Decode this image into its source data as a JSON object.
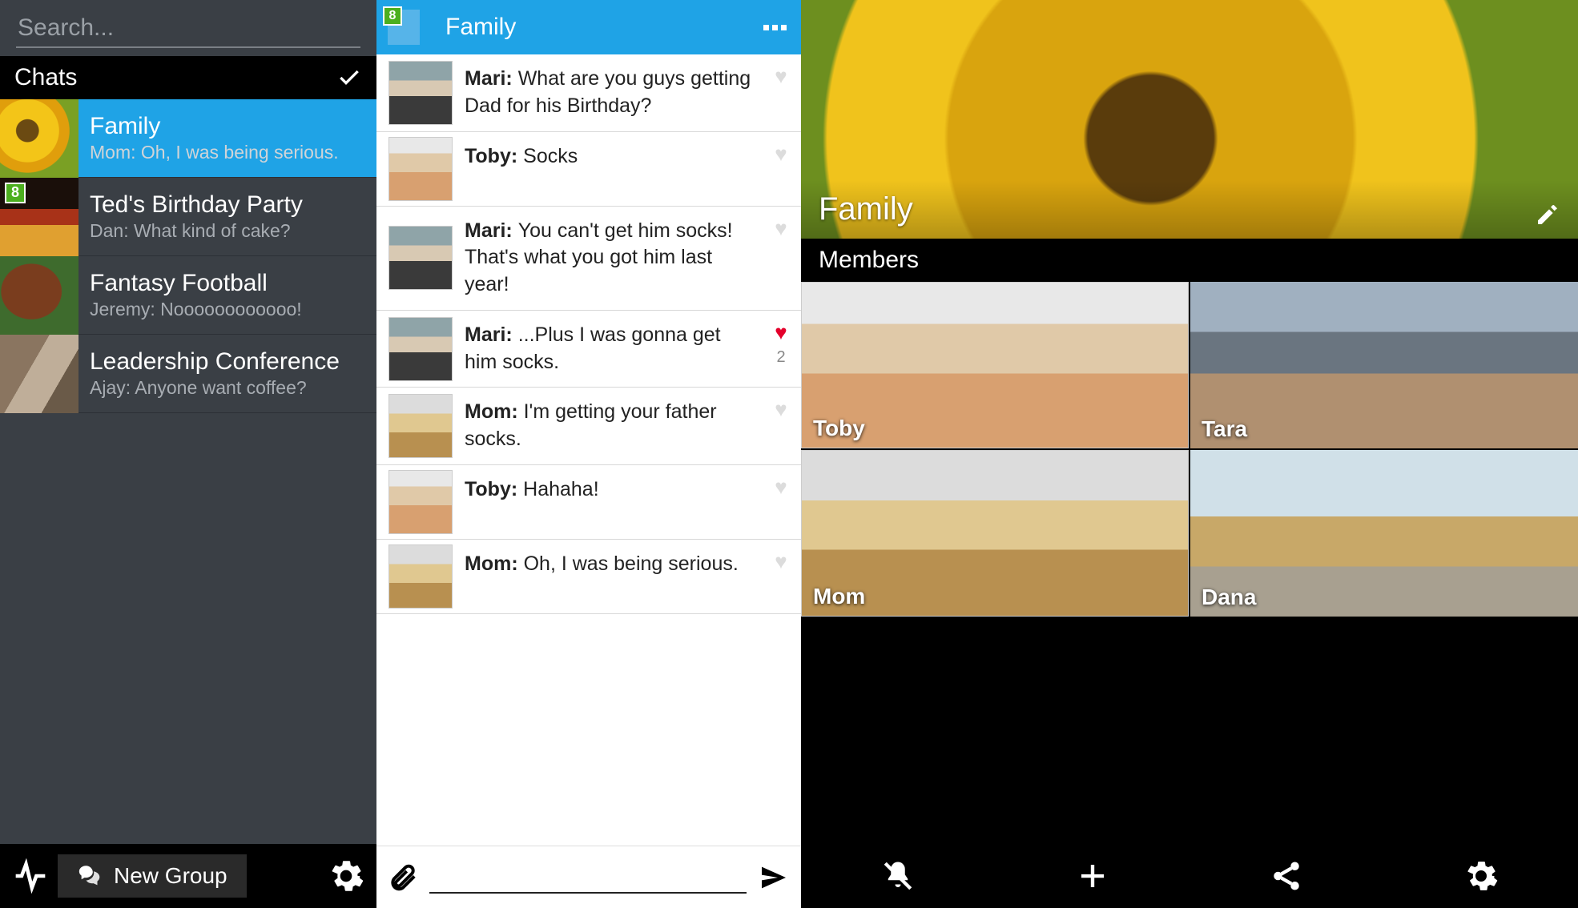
{
  "colors": {
    "accent": "#1fa3e6",
    "badge": "#4caf1f",
    "heart": "#e4002b"
  },
  "left": {
    "search_placeholder": "Search...",
    "header": "Chats",
    "new_group_label": "New Group",
    "chats": [
      {
        "title": "Family",
        "preview": "Mom: Oh, I was being serious.",
        "selected": true,
        "avatar": "av-sunflower",
        "badge": null
      },
      {
        "title": "Ted's Birthday Party",
        "preview": "Dan: What kind of cake?",
        "selected": false,
        "avatar": "av-candles",
        "badge": "8"
      },
      {
        "title": "Fantasy Football",
        "preview": "Jeremy: Noooooooooooo!",
        "selected": false,
        "avatar": "av-football",
        "badge": null
      },
      {
        "title": "Leadership Conference",
        "preview": "Ajay: Anyone want coffee?",
        "selected": false,
        "avatar": "av-people",
        "badge": null
      }
    ]
  },
  "mid": {
    "badge": "8",
    "title": "Family",
    "messages": [
      {
        "sender": "Mari",
        "text": "What are you guys getting Dad for his Birthday?",
        "avatar": "av-mari",
        "liked": false,
        "likes": null
      },
      {
        "sender": "Toby",
        "text": "Socks",
        "avatar": "av-toby",
        "liked": false,
        "likes": null
      },
      {
        "sender": "Mari",
        "text": "You can't get him socks! That's what you got him last year!",
        "avatar": "av-mari",
        "liked": false,
        "likes": null
      },
      {
        "sender": "Mari",
        "text": "...Plus I was gonna get him socks.",
        "avatar": "av-mari",
        "liked": true,
        "likes": "2"
      },
      {
        "sender": "Mom",
        "text": "I'm getting your father socks.",
        "avatar": "av-mom",
        "liked": false,
        "likes": null
      },
      {
        "sender": "Toby",
        "text": "Hahaha!",
        "avatar": "av-toby",
        "liked": false,
        "likes": null
      },
      {
        "sender": "Mom",
        "text": "Oh, I was being serious.",
        "avatar": "av-mom",
        "liked": false,
        "likes": null
      }
    ]
  },
  "right": {
    "title": "Family",
    "members_header": "Members",
    "members": [
      {
        "name": "Toby",
        "avatar": "av-toby"
      },
      {
        "name": "Tara",
        "avatar": "av-tara"
      },
      {
        "name": "Mom",
        "avatar": "av-mom"
      },
      {
        "name": "Dana",
        "avatar": "av-dana"
      }
    ]
  }
}
